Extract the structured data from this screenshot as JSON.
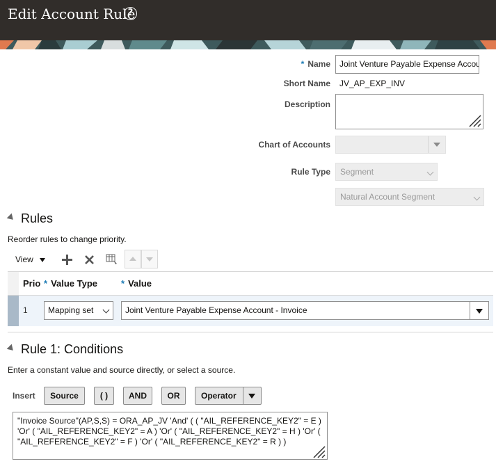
{
  "header": {
    "title": "Edit Account Rule"
  },
  "form": {
    "name_label": "Name",
    "name_value": "Joint Venture Payable Expense Account - Invoice",
    "short_name_label": "Short Name",
    "short_name_value": "JV_AP_EXP_INV",
    "description_label": "Description",
    "description_value": "",
    "coa_label": "Chart of Accounts",
    "coa_value": "",
    "rule_type_label": "Rule Type",
    "rule_type_value": "Segment",
    "segment_value": "Natural Account Segment"
  },
  "rules": {
    "title": "Rules",
    "hint": "Reorder rules to change priority.",
    "view_label": "View",
    "columns": {
      "priority": "Prio",
      "value_type": "Value Type",
      "value": "Value"
    },
    "rows": [
      {
        "priority": "1",
        "value_type": "Mapping set",
        "value": "Joint Venture Payable Expense Account - Invoice"
      }
    ]
  },
  "conditions": {
    "title": "Rule 1: Conditions",
    "hint": "Enter a constant value and source directly, or select a source.",
    "insert_label": "Insert",
    "buttons": {
      "source": "Source",
      "parens": "( )",
      "and": "AND",
      "or": "OR",
      "operator": "Operator"
    },
    "expression_lines": [
      "\"Invoice Source\"(AP,S,S) = ORA_AP_JV 'And' ( ( \"AIL_REFERENCE_KEY2\" = E )",
      "'Or' ( \"AIL_REFERENCE_KEY2\" = A ) 'Or' ( \"AIL_REFERENCE_KEY2\" = H ) 'Or' (",
      "\"AIL_REFERENCE_KEY2\" = F ) 'Or' ( \"AIL_REFERENCE_KEY2\" = R ) )"
    ]
  },
  "colors": {
    "header_bg": "#312d2a",
    "accent_blue": "#1d7cb5",
    "selected_row": "#eef4fa"
  }
}
